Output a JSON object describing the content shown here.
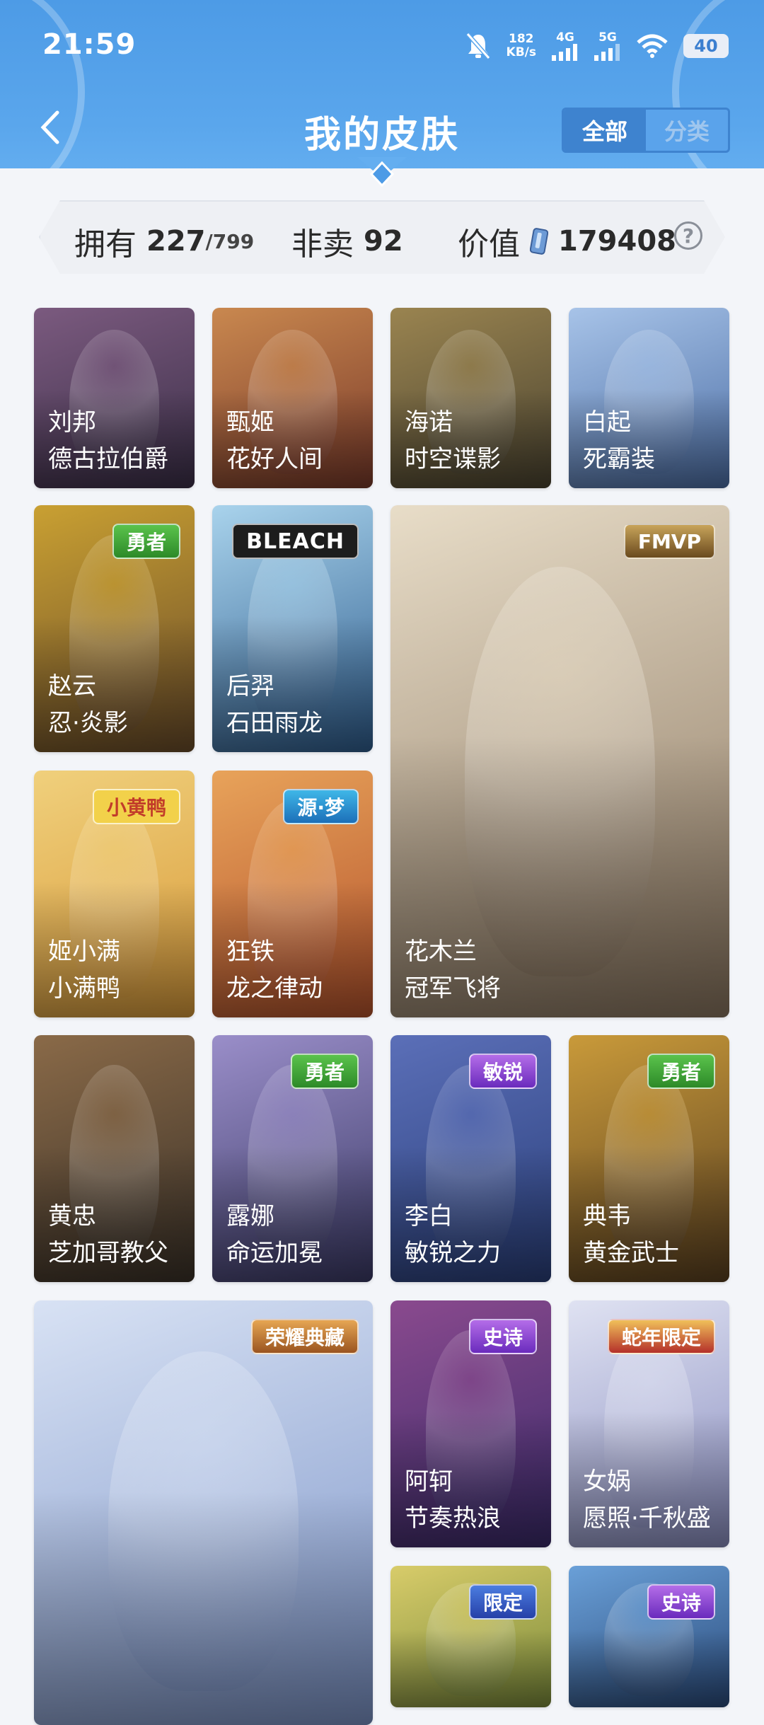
{
  "status_bar": {
    "time": "21:59",
    "speed_value": "182",
    "speed_unit": "KB/s",
    "net1": "4G",
    "net2": "5G",
    "battery": "40"
  },
  "header": {
    "title": "我的皮肤",
    "tabs": [
      {
        "label": "全部",
        "active": true
      },
      {
        "label": "分类",
        "active": false
      }
    ]
  },
  "stats": {
    "own_label": "拥有",
    "own_value": "227",
    "own_total": "/799",
    "not_for_sale_label": "非卖",
    "not_for_sale_value": "92",
    "value_label": "价值",
    "value_amount": "179408",
    "help": "?"
  },
  "skins": [
    {
      "hero": "刘邦",
      "skin": "德古拉伯爵",
      "badge": "",
      "badge_type": "",
      "colors": [
        "#3b2f48",
        "#7b5a7f"
      ]
    },
    {
      "hero": "甄姬",
      "skin": "花好人间",
      "badge": "",
      "badge_type": "",
      "colors": [
        "#7a3a2a",
        "#c9884f"
      ]
    },
    {
      "hero": "海诺",
      "skin": "时空谍影",
      "badge": "",
      "badge_type": "",
      "colors": [
        "#4a4330",
        "#9a8450"
      ]
    },
    {
      "hero": "白起",
      "skin": "死霸装",
      "badge": "",
      "badge_type": "",
      "colors": [
        "#4d6fa6",
        "#a7c3e8"
      ]
    },
    {
      "hero": "赵云",
      "skin": "忍·炎影",
      "badge": "勇者",
      "badge_type": "brave",
      "colors": [
        "#6a4c2a",
        "#c9a032"
      ]
    },
    {
      "hero": "后羿",
      "skin": "石田雨龙",
      "badge": "BLEACH",
      "badge_type": "collab",
      "colors": [
        "#2f5e8f",
        "#a9d3ec"
      ]
    },
    {
      "hero": "花木兰",
      "skin": "冠军飞将",
      "badge": "FMVP",
      "badge_type": "gold",
      "colors": [
        "#8a7660",
        "#e8ddc8"
      ]
    },
    {
      "hero": "姬小满",
      "skin": "小满鸭",
      "badge": "小黄鸭",
      "badge_type": "yellow",
      "colors": [
        "#d89a3a",
        "#f0d07c"
      ]
    },
    {
      "hero": "狂铁",
      "skin": "龙之律动",
      "badge": "源·梦",
      "badge_type": "cyan",
      "colors": [
        "#b4522c",
        "#e8a35a"
      ]
    },
    {
      "hero": "黄忠",
      "skin": "芝加哥教父",
      "badge": "",
      "badge_type": "",
      "colors": [
        "#3a3128",
        "#8a6a48"
      ]
    },
    {
      "hero": "露娜",
      "skin": "命运加冕",
      "badge": "勇者",
      "badge_type": "brave",
      "colors": [
        "#3b3a66",
        "#9a8ec9"
      ]
    },
    {
      "hero": "李白",
      "skin": "敏锐之力",
      "badge": "敏锐",
      "badge_type": "epic",
      "colors": [
        "#2a3f7a",
        "#5b6fb8"
      ]
    },
    {
      "hero": "典韦",
      "skin": "黄金武士",
      "badge": "勇者",
      "badge_type": "brave",
      "colors": [
        "#5a4020",
        "#c99a3a"
      ]
    },
    {
      "hero": "",
      "skin": "",
      "badge": "荣耀典藏",
      "badge_type": "glory",
      "colors": [
        "#7c94c8",
        "#d8e2f4"
      ]
    },
    {
      "hero": "阿轲",
      "skin": "节奏热浪",
      "badge": "史诗",
      "badge_type": "epic",
      "colors": [
        "#3a2a6a",
        "#8a4a8e"
      ]
    },
    {
      "hero": "女娲",
      "skin": "愿照·千秋盛",
      "badge": "蛇年限定",
      "badge_type": "red",
      "colors": [
        "#8a8ec0",
        "#dfe2f2"
      ]
    },
    {
      "hero": "",
      "skin": "",
      "badge": "限定",
      "badge_type": "limited",
      "colors": [
        "#7a8a3a",
        "#d8cc6a"
      ]
    },
    {
      "hero": "",
      "skin": "",
      "badge": "史诗",
      "badge_type": "epic",
      "colors": [
        "#2a4a7a",
        "#6aa0d8"
      ]
    }
  ]
}
